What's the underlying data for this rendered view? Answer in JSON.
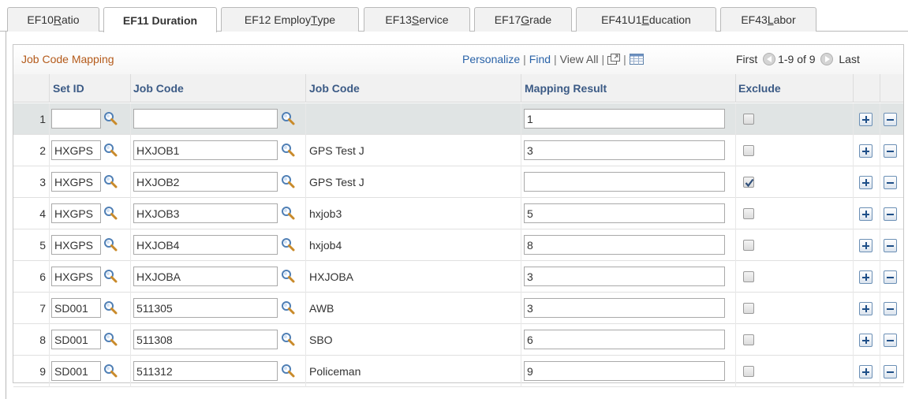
{
  "tabs": [
    {
      "pre": "EF10 ",
      "u": "R",
      "post": "atio",
      "active": false
    },
    {
      "pre": "EF11 Duration",
      "u": "",
      "post": "",
      "active": true
    },
    {
      "pre": "EF12 Employ ",
      "u": "T",
      "post": "ype",
      "active": false
    },
    {
      "pre": "EF13 ",
      "u": "S",
      "post": "ervice",
      "active": false
    },
    {
      "pre": "EF17 ",
      "u": "G",
      "post": "rade",
      "active": false
    },
    {
      "pre": "EF41U1 ",
      "u": "E",
      "post": "ducation",
      "active": false
    },
    {
      "pre": "EF43 ",
      "u": "L",
      "post": "abor",
      "active": false
    }
  ],
  "grid": {
    "title": "Job Code Mapping",
    "personalize": "Personalize",
    "find": "Find",
    "view_all": "View All",
    "sep": "|",
    "first": "First",
    "range": "1-9 of 9",
    "last": "Last",
    "columns": {
      "setid": "Set ID",
      "jobcode": "Job Code",
      "descr": "Job Code",
      "mapping": "Mapping Result",
      "exclude": "Exclude"
    },
    "rows": [
      {
        "num": "1",
        "setid": "",
        "jobcode": "",
        "descr": "",
        "mapping": "1",
        "exclude": false
      },
      {
        "num": "2",
        "setid": "HXGPS",
        "jobcode": "HXJOB1",
        "descr": "GPS Test J",
        "mapping": "3",
        "exclude": false
      },
      {
        "num": "3",
        "setid": "HXGPS",
        "jobcode": "HXJOB2",
        "descr": "GPS Test J",
        "mapping": "",
        "exclude": true
      },
      {
        "num": "4",
        "setid": "HXGPS",
        "jobcode": "HXJOB3",
        "descr": "hxjob3",
        "mapping": "5",
        "exclude": false
      },
      {
        "num": "5",
        "setid": "HXGPS",
        "jobcode": "HXJOB4",
        "descr": "hxjob4",
        "mapping": "8",
        "exclude": false
      },
      {
        "num": "6",
        "setid": "HXGPS",
        "jobcode": "HXJOBA",
        "descr": "HXJOBA",
        "mapping": "3",
        "exclude": false
      },
      {
        "num": "7",
        "setid": "SD001",
        "jobcode": "511305",
        "descr": "AWB",
        "mapping": "3",
        "exclude": false
      },
      {
        "num": "8",
        "setid": "SD001",
        "jobcode": "511308",
        "descr": "SBO",
        "mapping": "6",
        "exclude": false
      },
      {
        "num": "9",
        "setid": "SD001",
        "jobcode": "511312",
        "descr": "Policeman",
        "mapping": "9",
        "exclude": false
      }
    ]
  }
}
